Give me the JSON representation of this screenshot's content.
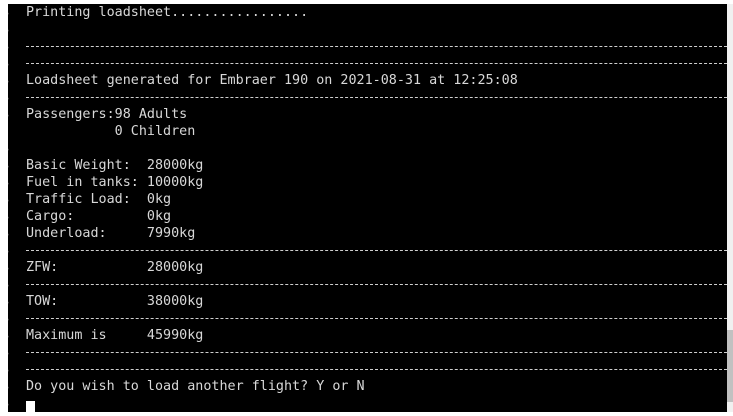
{
  "terminal": {
    "prompt": "$",
    "lines": [
      {
        "kind": "text",
        "text": "Printing loadsheet................."
      },
      {
        "kind": "blank"
      },
      {
        "kind": "sep"
      },
      {
        "kind": "sep"
      },
      {
        "kind": "text",
        "text": "Loadsheet generated for Embraer 190 on 2021-08-31 at 12:25:08"
      },
      {
        "kind": "sep"
      },
      {
        "kind": "text",
        "text": "Passengers:98 Adults"
      },
      {
        "kind": "text",
        "text": "           0 Children",
        "noprompt": true
      },
      {
        "kind": "blank"
      },
      {
        "kind": "text",
        "text": "Basic Weight:  28000kg"
      },
      {
        "kind": "text",
        "text": "Fuel in tanks: 10000kg"
      },
      {
        "kind": "text",
        "text": "Traffic Load:  0kg"
      },
      {
        "kind": "text",
        "text": "Cargo:         0kg"
      },
      {
        "kind": "text",
        "text": "Underload:     7990kg"
      },
      {
        "kind": "sep"
      },
      {
        "kind": "text",
        "text": "ZFW:           28000kg"
      },
      {
        "kind": "sep"
      },
      {
        "kind": "text",
        "text": "TOW:           38000kg"
      },
      {
        "kind": "sep"
      },
      {
        "kind": "text",
        "text": "Maximum is     45990kg"
      },
      {
        "kind": "sep"
      },
      {
        "kind": "sep"
      },
      {
        "kind": "text",
        "text": "Do you wish to load another flight? Y or N"
      },
      {
        "kind": "input"
      }
    ]
  }
}
